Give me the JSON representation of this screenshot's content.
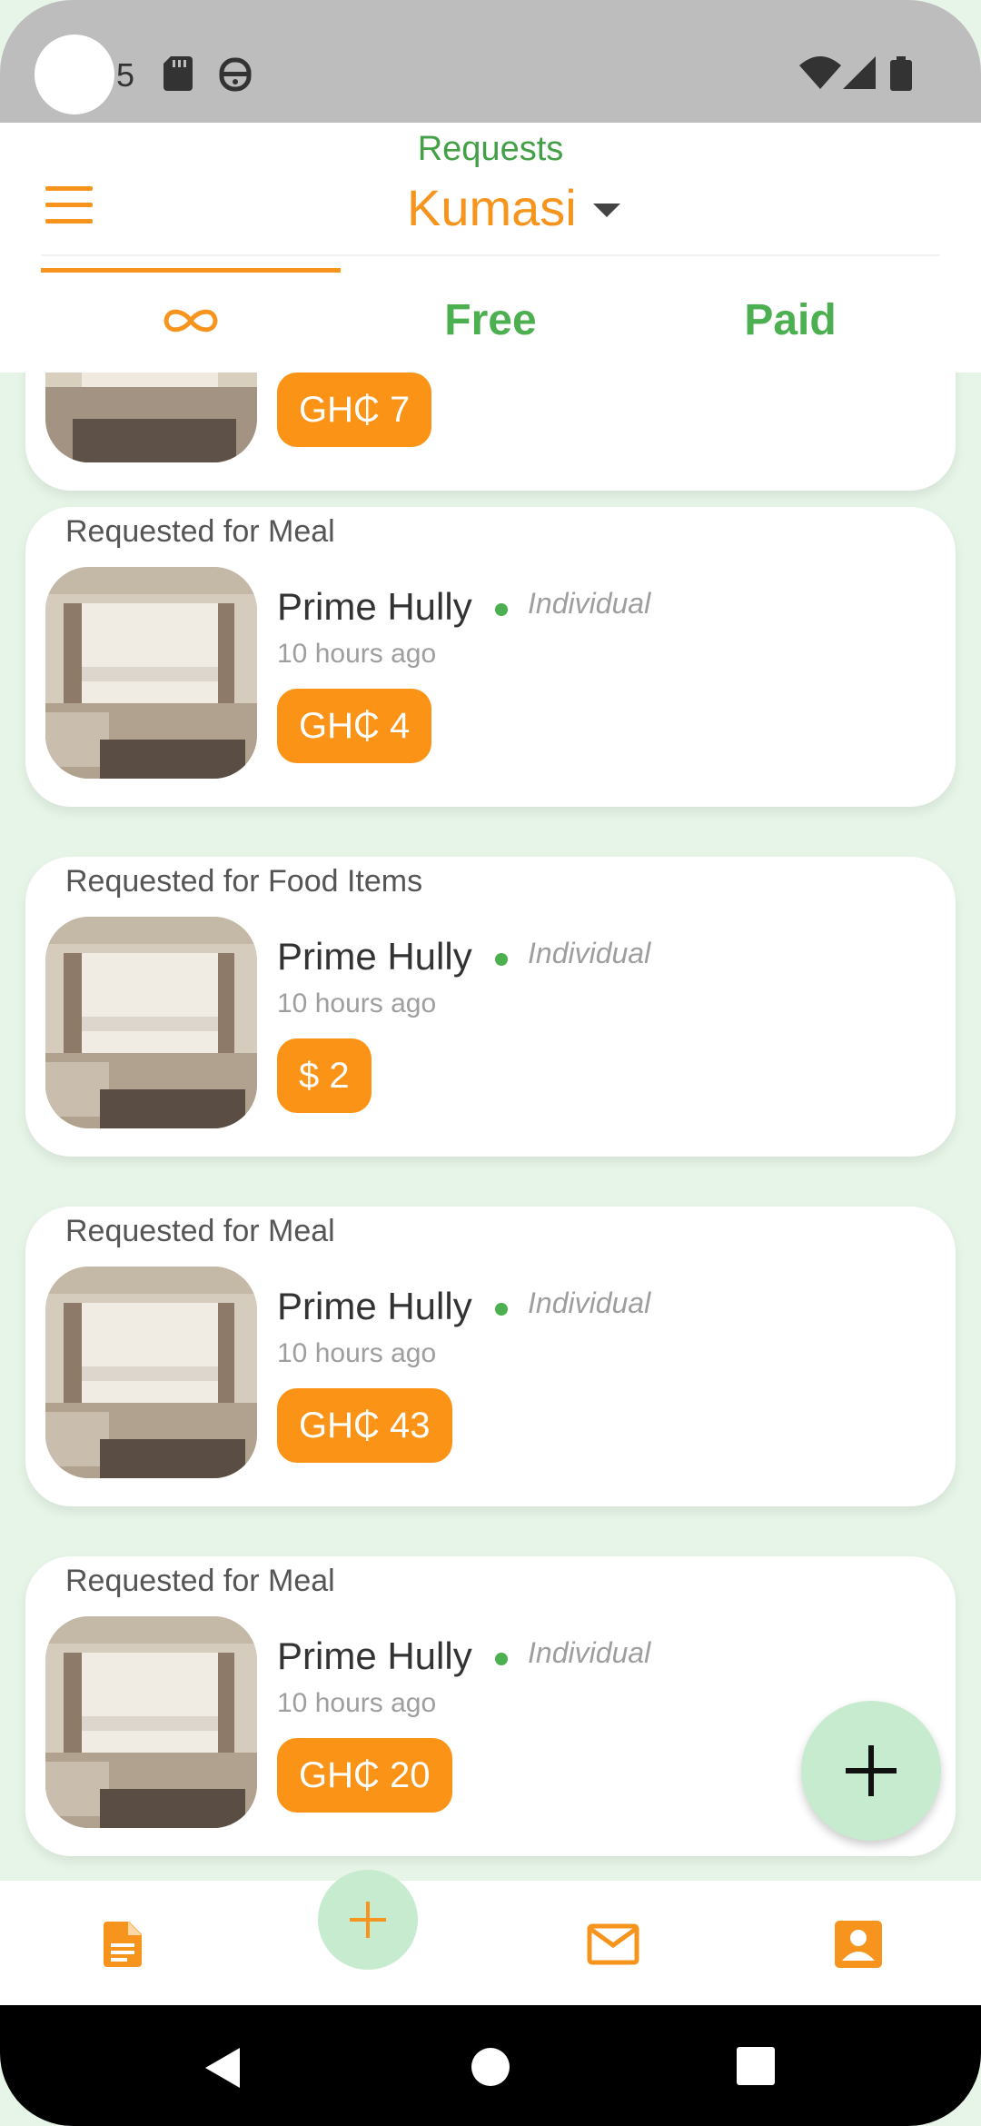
{
  "status_bar": {
    "notification_count": "5",
    "icons": [
      "sd-card-icon",
      "robot-icon",
      "wifi-icon",
      "signal-icon",
      "battery-icon"
    ]
  },
  "header": {
    "title": "Requests",
    "city": "Kumasi",
    "menu_icon": "hamburger-menu-icon"
  },
  "tabs": [
    {
      "label": "∞",
      "icon": "infinity-icon",
      "active": true
    },
    {
      "label": "Free",
      "active": false
    },
    {
      "label": "Paid",
      "active": false
    }
  ],
  "partial_card": {
    "price": "GH₵ 7"
  },
  "requests": [
    {
      "heading": "Requested for Meal",
      "name": "Prime Hully",
      "type": "Individual",
      "time": "10 hours ago",
      "price": "GH₵ 4"
    },
    {
      "heading": "Requested for Food Items",
      "name": "Prime Hully",
      "type": "Individual",
      "time": "10 hours ago",
      "price": "$ 2"
    },
    {
      "heading": "Requested for Meal",
      "name": "Prime Hully",
      "type": "Individual",
      "time": "10 hours ago",
      "price": "GH₵ 43"
    },
    {
      "heading": "Requested for Meal",
      "name": "Prime Hully",
      "type": "Individual",
      "time": "10 hours ago",
      "price": "GH₵ 20"
    }
  ],
  "bottom_nav": {
    "items": [
      "document-icon",
      "add-icon",
      "mail-icon",
      "account-icon"
    ]
  },
  "colors": {
    "accent_orange": "#f7941d",
    "accent_green": "#4caf50",
    "fab_green": "#c7ebce",
    "background": "#e7f5e8"
  }
}
